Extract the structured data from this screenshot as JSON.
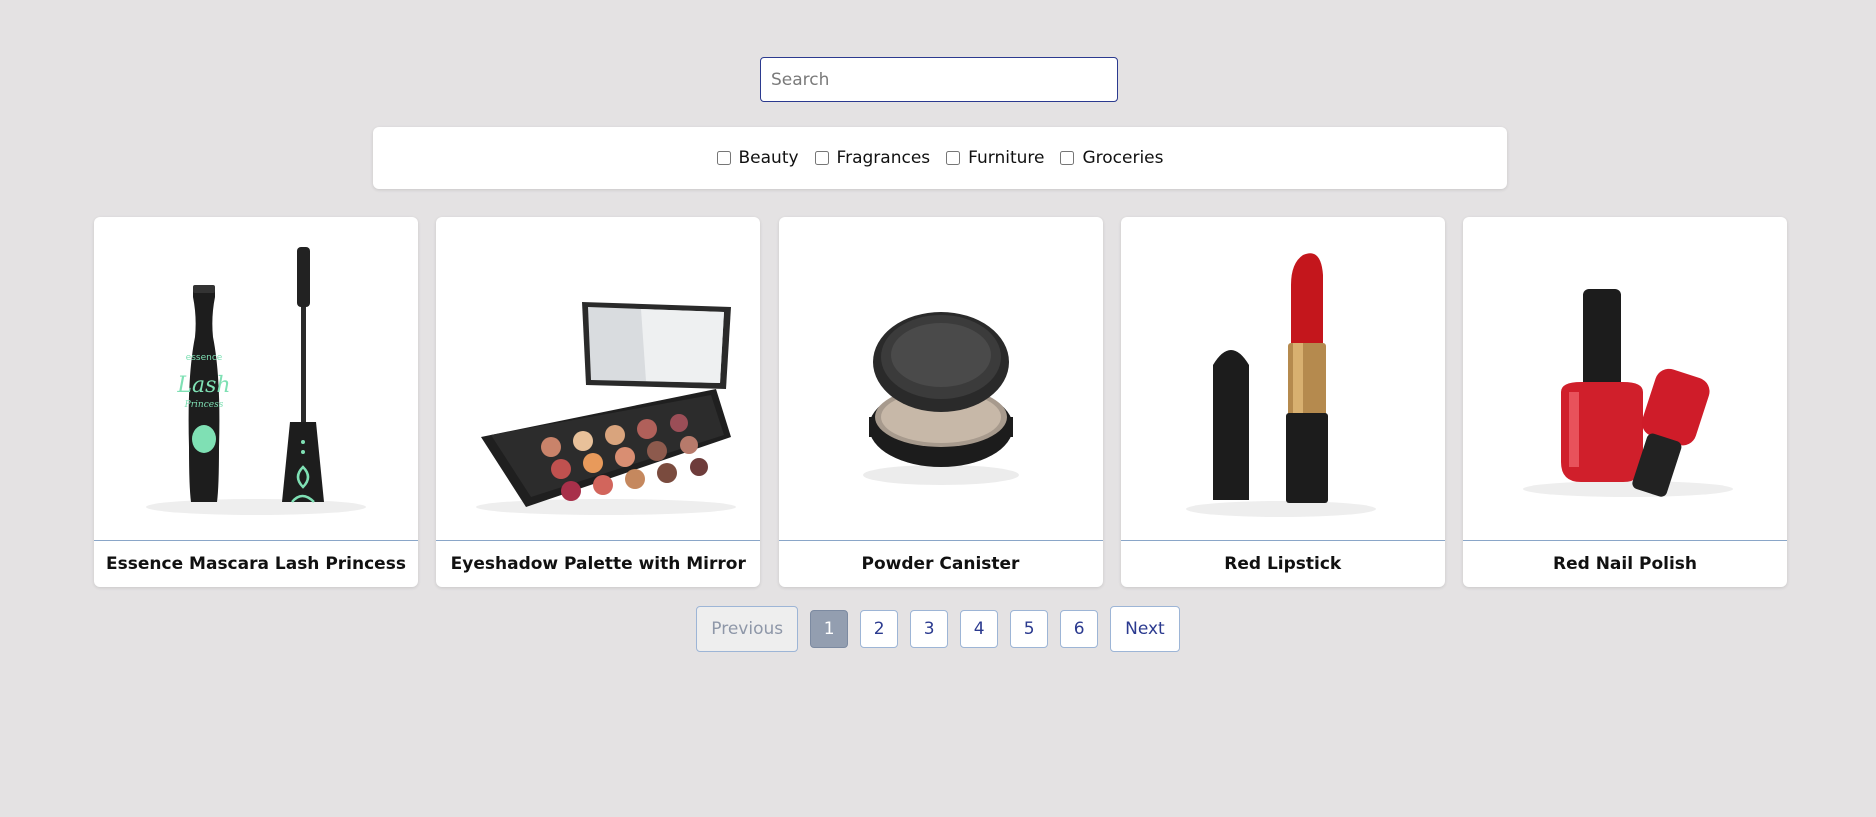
{
  "search": {
    "placeholder": "Search",
    "value": ""
  },
  "filters": [
    {
      "label": "Beauty",
      "checked": false
    },
    {
      "label": "Fragrances",
      "checked": false
    },
    {
      "label": "Furniture",
      "checked": false
    },
    {
      "label": "Groceries",
      "checked": false
    }
  ],
  "products": [
    {
      "title": "Essence Mascara Lash Princess",
      "icon": "mascara-image"
    },
    {
      "title": "Eyeshadow Palette with Mirror",
      "icon": "eyeshadow-palette-image"
    },
    {
      "title": "Powder Canister",
      "icon": "powder-canister-image"
    },
    {
      "title": "Red Lipstick",
      "icon": "lipstick-image"
    },
    {
      "title": "Red Nail Polish",
      "icon": "nail-polish-image"
    }
  ],
  "pagination": {
    "previous": "Previous",
    "next": "Next",
    "pages": [
      "1",
      "2",
      "3",
      "4",
      "5",
      "6"
    ],
    "current": "1"
  },
  "colors": {
    "background": "#e4e2e3",
    "accent": "#2b3a8f",
    "active_page": "#939eb0"
  }
}
